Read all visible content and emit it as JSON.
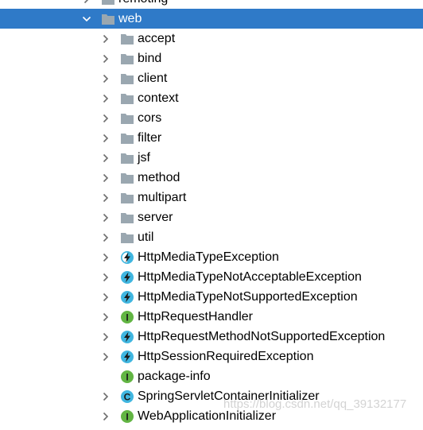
{
  "tree": {
    "items": [
      {
        "label": "remoting",
        "kind": "folder",
        "expandable": true,
        "expanded": false,
        "depth": 0,
        "selected": false
      },
      {
        "label": "web",
        "kind": "folder",
        "expandable": true,
        "expanded": true,
        "depth": 0,
        "selected": true
      },
      {
        "label": "accept",
        "kind": "folder",
        "expandable": true,
        "expanded": false,
        "depth": 1,
        "selected": false
      },
      {
        "label": "bind",
        "kind": "folder",
        "expandable": true,
        "expanded": false,
        "depth": 1,
        "selected": false
      },
      {
        "label": "client",
        "kind": "folder",
        "expandable": true,
        "expanded": false,
        "depth": 1,
        "selected": false
      },
      {
        "label": "context",
        "kind": "folder",
        "expandable": true,
        "expanded": false,
        "depth": 1,
        "selected": false
      },
      {
        "label": "cors",
        "kind": "folder",
        "expandable": true,
        "expanded": false,
        "depth": 1,
        "selected": false
      },
      {
        "label": "filter",
        "kind": "folder",
        "expandable": true,
        "expanded": false,
        "depth": 1,
        "selected": false
      },
      {
        "label": "jsf",
        "kind": "folder",
        "expandable": true,
        "expanded": false,
        "depth": 1,
        "selected": false
      },
      {
        "label": "method",
        "kind": "folder",
        "expandable": true,
        "expanded": false,
        "depth": 1,
        "selected": false
      },
      {
        "label": "multipart",
        "kind": "folder",
        "expandable": true,
        "expanded": false,
        "depth": 1,
        "selected": false
      },
      {
        "label": "server",
        "kind": "folder",
        "expandable": true,
        "expanded": false,
        "depth": 1,
        "selected": false
      },
      {
        "label": "util",
        "kind": "folder",
        "expandable": true,
        "expanded": false,
        "depth": 1,
        "selected": false
      },
      {
        "label": "HttpMediaTypeException",
        "kind": "exception-abstract",
        "expandable": true,
        "expanded": false,
        "depth": 1,
        "selected": false
      },
      {
        "label": "HttpMediaTypeNotAcceptableException",
        "kind": "exception",
        "expandable": true,
        "expanded": false,
        "depth": 1,
        "selected": false
      },
      {
        "label": "HttpMediaTypeNotSupportedException",
        "kind": "exception",
        "expandable": true,
        "expanded": false,
        "depth": 1,
        "selected": false
      },
      {
        "label": "HttpRequestHandler",
        "kind": "interface",
        "expandable": true,
        "expanded": false,
        "depth": 1,
        "selected": false
      },
      {
        "label": "HttpRequestMethodNotSupportedException",
        "kind": "exception",
        "expandable": true,
        "expanded": false,
        "depth": 1,
        "selected": false
      },
      {
        "label": "HttpSessionRequiredException",
        "kind": "exception",
        "expandable": true,
        "expanded": false,
        "depth": 1,
        "selected": false
      },
      {
        "label": "package-info",
        "kind": "interface",
        "expandable": false,
        "expanded": false,
        "depth": 1,
        "selected": false
      },
      {
        "label": "SpringServletContainerInitializer",
        "kind": "class",
        "expandable": true,
        "expanded": false,
        "depth": 1,
        "selected": false
      },
      {
        "label": "WebApplicationInitializer",
        "kind": "interface",
        "expandable": true,
        "expanded": false,
        "depth": 1,
        "selected": false
      }
    ]
  },
  "watermark": "https://blog.csdn.net/qq_39132177",
  "colors": {
    "selection": "#2f7ac8",
    "folder": "#9aa7b0",
    "interface": "#62b543",
    "class": "#40b6e0",
    "exception_bolt": "#1a1a1a"
  }
}
